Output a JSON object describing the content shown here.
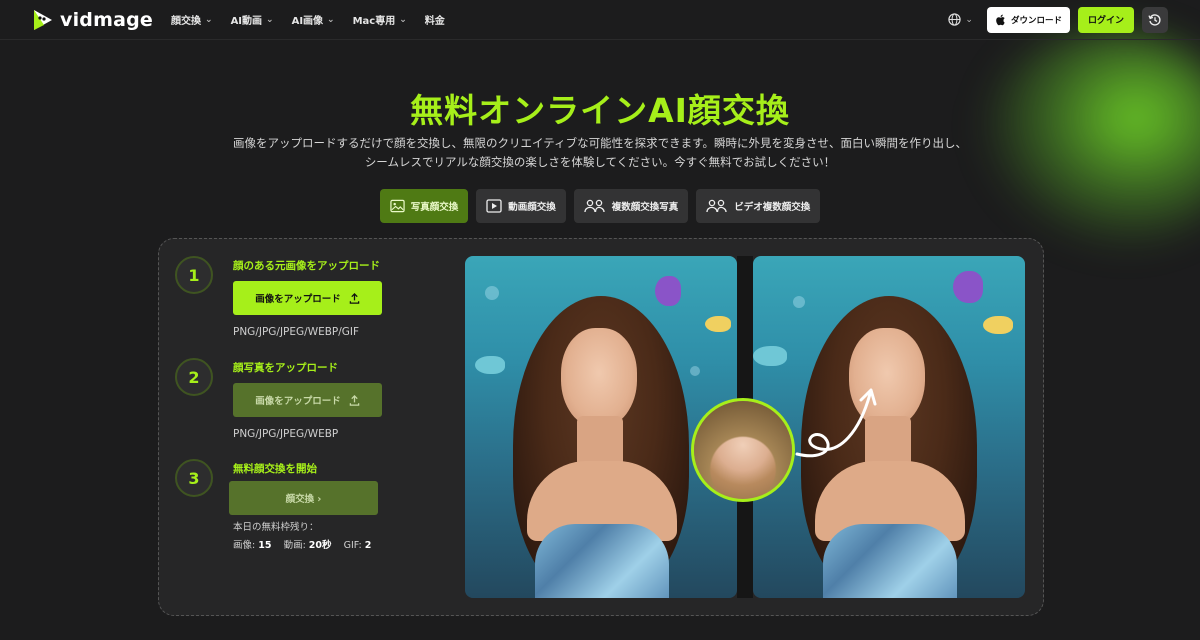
{
  "nav": {
    "brand": "vidmage",
    "menu": [
      {
        "label": "顔交換",
        "has_dropdown": true
      },
      {
        "label": "AI動画",
        "has_dropdown": true
      },
      {
        "label": "AI画像",
        "has_dropdown": true
      },
      {
        "label": "Mac専用",
        "has_dropdown": true
      },
      {
        "label": "料金",
        "has_dropdown": false
      }
    ],
    "download_label": "ダウンロード",
    "login_label": "ログイン"
  },
  "hero": {
    "title": "無料オンラインAI顔交換",
    "description_line1": "画像をアップロードするだけで顔を交換し、無限のクリエイティブな可能性を探求できます。瞬時に外見を変身させ、面白い瞬間を作り出し、",
    "description_line2": "シームレスでリアルな顔交換の楽しさを体験してください。今すぐ無料でお試しください！"
  },
  "tabs": [
    {
      "label": "写真顔交換",
      "icon": "image-icon",
      "active": true
    },
    {
      "label": "動画顔交換",
      "icon": "play-icon",
      "active": false
    },
    {
      "label": "複数顔交換写真",
      "icon": "multi-user-icon",
      "active": false
    },
    {
      "label": "ビデオ複数顔交換",
      "icon": "multi-user-icon",
      "active": false
    }
  ],
  "steps": [
    {
      "num": "1",
      "title": "顔のある元画像をアップロード",
      "button": "画像をアップロード",
      "formats": "PNG/JPG/JPEG/WEBP/GIF"
    },
    {
      "num": "2",
      "title": "顔写真をアップロード",
      "button": "画像をアップロード",
      "formats": "PNG/JPG/JPEG/WEBP"
    },
    {
      "num": "3",
      "title": "無料顔交換を開始",
      "button": "顔交換 ›"
    }
  ],
  "remaining": {
    "label": "本日の無料枠残り：",
    "image_label": "画像:",
    "image_value": "15",
    "video_label": "動画:",
    "video_value": "20秒",
    "gif_label": "GIF:",
    "gif_value": "2"
  },
  "colors": {
    "accent": "#a6ef1a",
    "background": "#1c1c1d",
    "panel": "#262627",
    "tab_active": "#4f7a14"
  }
}
